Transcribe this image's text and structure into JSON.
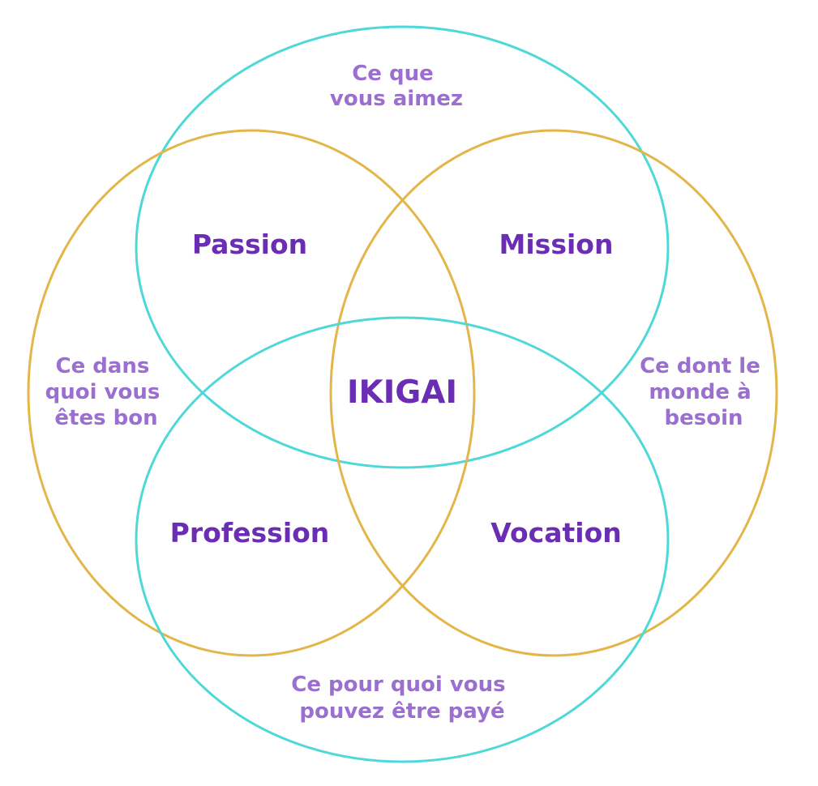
{
  "circles": {
    "top": "Ce que vous aimez",
    "left": "Ce dans quoi vous êtes bon",
    "right": "Ce dont le monde à besoin",
    "bottom": "Ce pour quoi vous pouvez être payé"
  },
  "circle_lines": {
    "top": [
      "Ce que",
      "vous aimez"
    ],
    "left": [
      "Ce dans",
      "quoi vous",
      "êtes bon"
    ],
    "right": [
      "Ce dont le",
      "monde à",
      "besoin"
    ],
    "bottom": [
      "Ce pour quoi vous",
      "pouvez être payé"
    ]
  },
  "intersections": {
    "top_left": "Passion",
    "top_right": "Mission",
    "bottom_left": "Profession",
    "bottom_right": "Vocation"
  },
  "center": "IKIGAI",
  "colors": {
    "blue_circle": "#4fd8d8",
    "gold_circle": "#e3b64a",
    "label_light": "#9b6fd0",
    "label_dark": "#6a2db3"
  }
}
